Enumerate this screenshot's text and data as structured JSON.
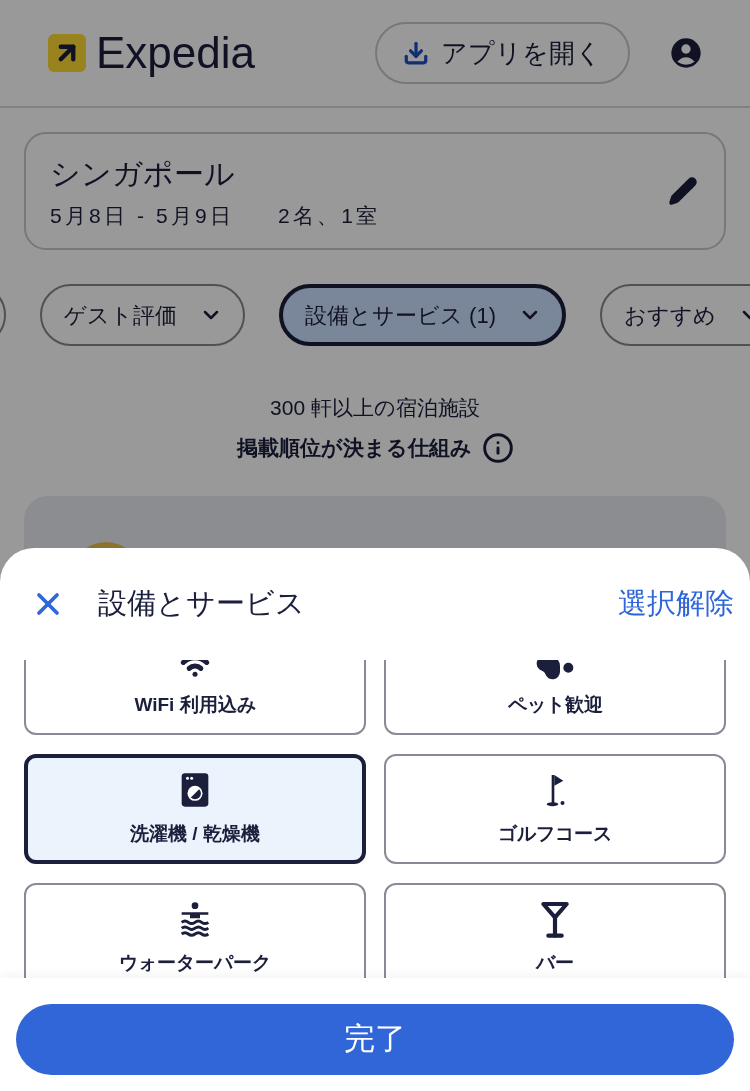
{
  "header": {
    "logo": "Expedia",
    "app_button": "アプリを開く"
  },
  "search": {
    "destination": "シンガポール",
    "dates": "5月8日 - 5月9日",
    "guests": "2名、1室"
  },
  "filters": [
    {
      "label": "ゲスト評価",
      "selected": false
    },
    {
      "label": "設備とサービス (1)",
      "selected": true
    },
    {
      "label": "おすすめ",
      "selected": false
    }
  ],
  "results": {
    "count": "300 軒以上の宿泊施設",
    "ranking_link": "掲載順位が決まる仕組み"
  },
  "sheet": {
    "title": "設備とサービス",
    "clear": "選択解除",
    "done": "完了",
    "options": [
      {
        "kind": "wifi",
        "label": "WiFi 利用込み",
        "selected": false
      },
      {
        "kind": "pet",
        "label": "ペット歓迎",
        "selected": false
      },
      {
        "kind": "washer",
        "label": "洗濯機 / 乾燥機",
        "selected": true
      },
      {
        "kind": "golf",
        "label": "ゴルフコース",
        "selected": false
      },
      {
        "kind": "waterpark",
        "label": "ウォーターパーク",
        "selected": false
      },
      {
        "kind": "bar",
        "label": "バー",
        "selected": false
      }
    ]
  }
}
